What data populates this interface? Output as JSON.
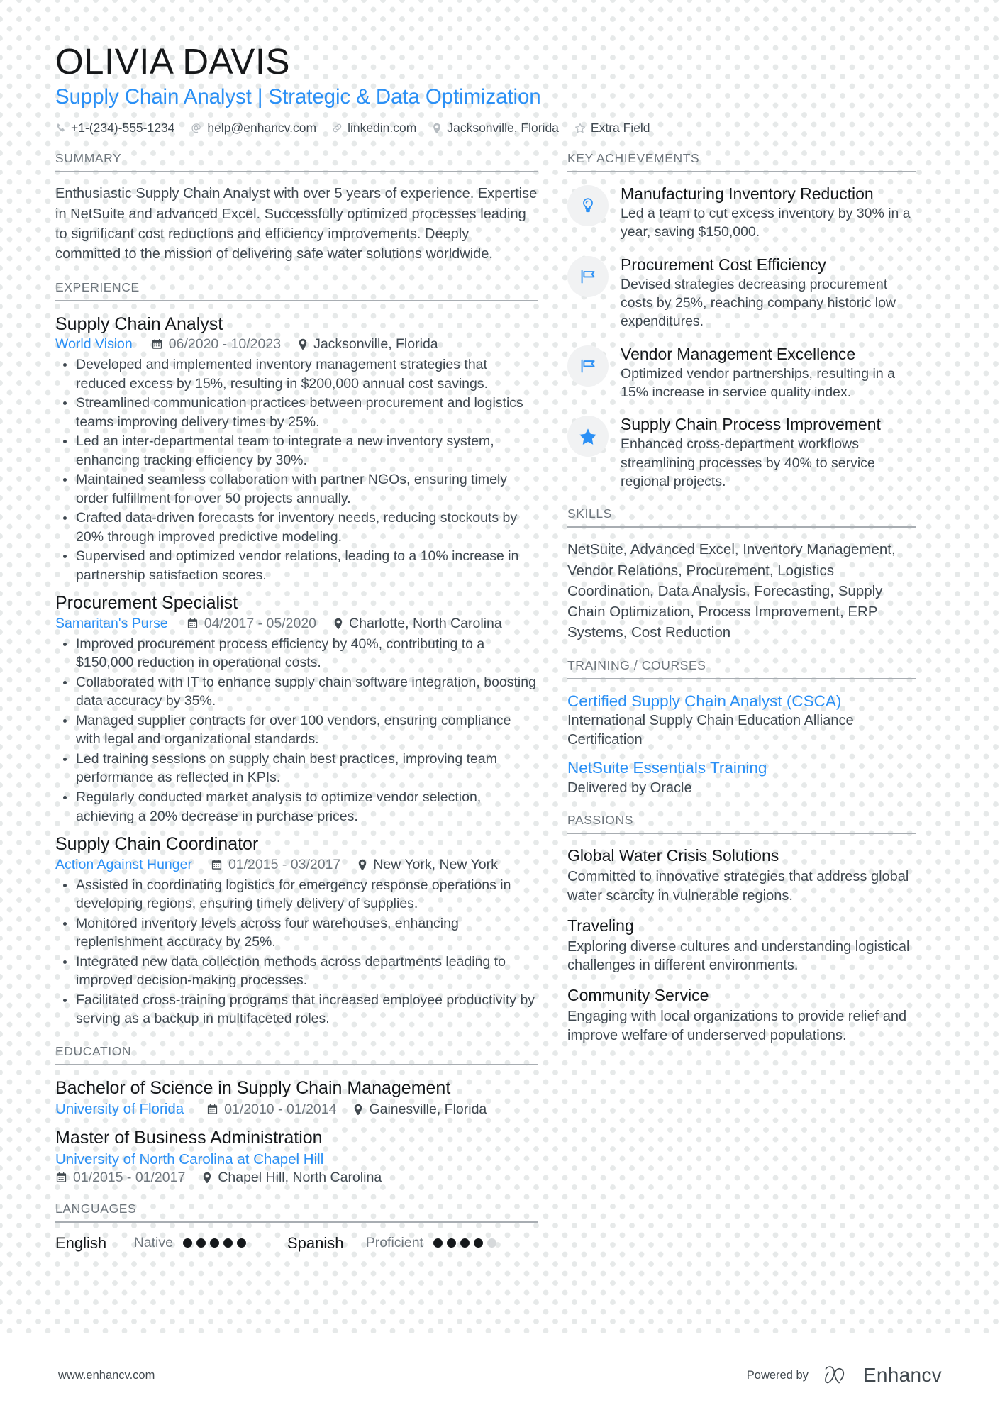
{
  "header": {
    "name": "OLIVIA DAVIS",
    "headline": "Supply Chain Analyst | Strategic & Data Optimization",
    "contacts": [
      {
        "icon": "phone-icon",
        "text": "+1-(234)-555-1234"
      },
      {
        "icon": "email-icon",
        "text": "help@enhancv.com"
      },
      {
        "icon": "link-icon",
        "text": "linkedin.com"
      },
      {
        "icon": "location-pin-icon",
        "text": "Jacksonville, Florida"
      },
      {
        "icon": "star-outline-icon",
        "text": "Extra Field"
      }
    ]
  },
  "summary": {
    "title": "SUMMARY",
    "text": "Enthusiastic Supply Chain Analyst with over 5 years of experience. Expertise in NetSuite and advanced Excel. Successfully optimized processes leading to significant cost reductions and efficiency improvements. Deeply committed to the mission of delivering safe water solutions worldwide."
  },
  "experience": {
    "title": "EXPERIENCE",
    "entries": [
      {
        "role": "Supply Chain Analyst",
        "organization": "World Vision",
        "dates": "06/2020 - 10/2023",
        "location": "Jacksonville, Florida",
        "bullets": [
          "Developed and implemented inventory management strategies that reduced excess by 15%, resulting in $200,000 annual cost savings.",
          "Streamlined communication practices between procurement and logistics teams improving delivery times by 25%.",
          "Led an inter-departmental team to integrate a new inventory system, enhancing tracking efficiency by 30%.",
          "Maintained seamless collaboration with partner NGOs, ensuring timely order fulfillment for over 50 projects annually.",
          "Crafted data-driven forecasts for inventory needs, reducing stockouts by 20% through improved predictive modeling.",
          "Supervised and optimized vendor relations, leading to a 10% increase in partnership satisfaction scores."
        ]
      },
      {
        "role": "Procurement Specialist",
        "organization": "Samaritan's Purse",
        "dates": "04/2017 - 05/2020",
        "location": "Charlotte, North Carolina",
        "bullets": [
          "Improved procurement process efficiency by 40%, contributing to a $150,000 reduction in operational costs.",
          "Collaborated with IT to enhance supply chain software integration, boosting data accuracy by 35%.",
          "Managed supplier contracts for over 100 vendors, ensuring compliance with legal and organizational standards.",
          "Led training sessions on supply chain best practices, improving team performance as reflected in KPIs.",
          "Regularly conducted market analysis to optimize vendor selection, achieving a 20% decrease in purchase prices."
        ]
      },
      {
        "role": "Supply Chain Coordinator",
        "organization": "Action Against Hunger",
        "dates": "01/2015 - 03/2017",
        "location": "New York, New York",
        "bullets": [
          "Assisted in coordinating logistics for emergency response operations in developing regions, ensuring timely delivery of supplies.",
          "Monitored inventory levels across four warehouses, enhancing replenishment accuracy by 25%.",
          "Integrated new data collection methods across departments leading to improved decision-making processes.",
          "Facilitated cross-training programs that increased employee productivity by serving as a backup in multifaceted roles."
        ]
      }
    ]
  },
  "education": {
    "title": "EDUCATION",
    "entries": [
      {
        "degree": "Bachelor of Science in Supply Chain Management",
        "school": "University of Florida",
        "dates": "01/2010 - 01/2014",
        "location": "Gainesville, Florida",
        "wrap": false
      },
      {
        "degree": "Master of Business Administration",
        "school": "University of North Carolina at Chapel Hill",
        "dates": "01/2015 - 01/2017",
        "location": "Chapel Hill, North Carolina",
        "wrap": true
      }
    ]
  },
  "languages": {
    "title": "LANGUAGES",
    "items": [
      {
        "name": "English",
        "level": "Native",
        "filled": 5,
        "total": 5
      },
      {
        "name": "Spanish",
        "level": "Proficient",
        "filled": 4,
        "total": 5
      }
    ]
  },
  "key_achievements": {
    "title": "KEY ACHIEVEMENTS",
    "items": [
      {
        "icon": "lightbulb-icon",
        "title": "Manufacturing Inventory Reduction",
        "description": "Led a team to cut excess inventory by 30% in a year, saving $150,000."
      },
      {
        "icon": "flag-icon",
        "title": "Procurement Cost Efficiency",
        "description": "Devised strategies decreasing procurement costs by 25%, reaching company historic low expenditures."
      },
      {
        "icon": "flag-icon",
        "title": "Vendor Management Excellence",
        "description": "Optimized vendor partnerships, resulting in a 15% increase in service quality index."
      },
      {
        "icon": "star-filled-icon",
        "title": "Supply Chain Process Improvement",
        "description": "Enhanced cross-department workflows streamlining processes by 40% to service regional projects."
      }
    ]
  },
  "skills": {
    "title": "SKILLS",
    "text": "NetSuite, Advanced Excel, Inventory Management, Vendor Relations, Procurement, Logistics Coordination, Data Analysis, Forecasting, Supply Chain Optimization, Process Improvement, ERP Systems, Cost Reduction"
  },
  "training": {
    "title": "TRAINING / COURSES",
    "items": [
      {
        "name": "Certified Supply Chain Analyst (CSCA)",
        "description": "International Supply Chain Education Alliance Certification"
      },
      {
        "name": "NetSuite Essentials Training",
        "description": "Delivered by Oracle"
      }
    ]
  },
  "passions": {
    "title": "PASSIONS",
    "items": [
      {
        "title": "Global Water Crisis Solutions",
        "description": "Committed to innovative strategies that address global water scarcity in vulnerable regions."
      },
      {
        "title": "Traveling",
        "description": "Exploring diverse cultures and understanding logistical challenges in different environments."
      },
      {
        "title": "Community Service",
        "description": "Engaging with local organizations to provide relief and improve welfare of underserved populations."
      }
    ]
  },
  "footer": {
    "url": "www.enhancv.com",
    "powered_by": "Powered by",
    "brand": "Enhancv"
  },
  "colors": {
    "accent": "#2b90f5",
    "heading": "#15181b",
    "body": "#3f4850",
    "muted": "#6d757c",
    "rule": "#a8adb2",
    "dot": "#e6e9e9"
  }
}
